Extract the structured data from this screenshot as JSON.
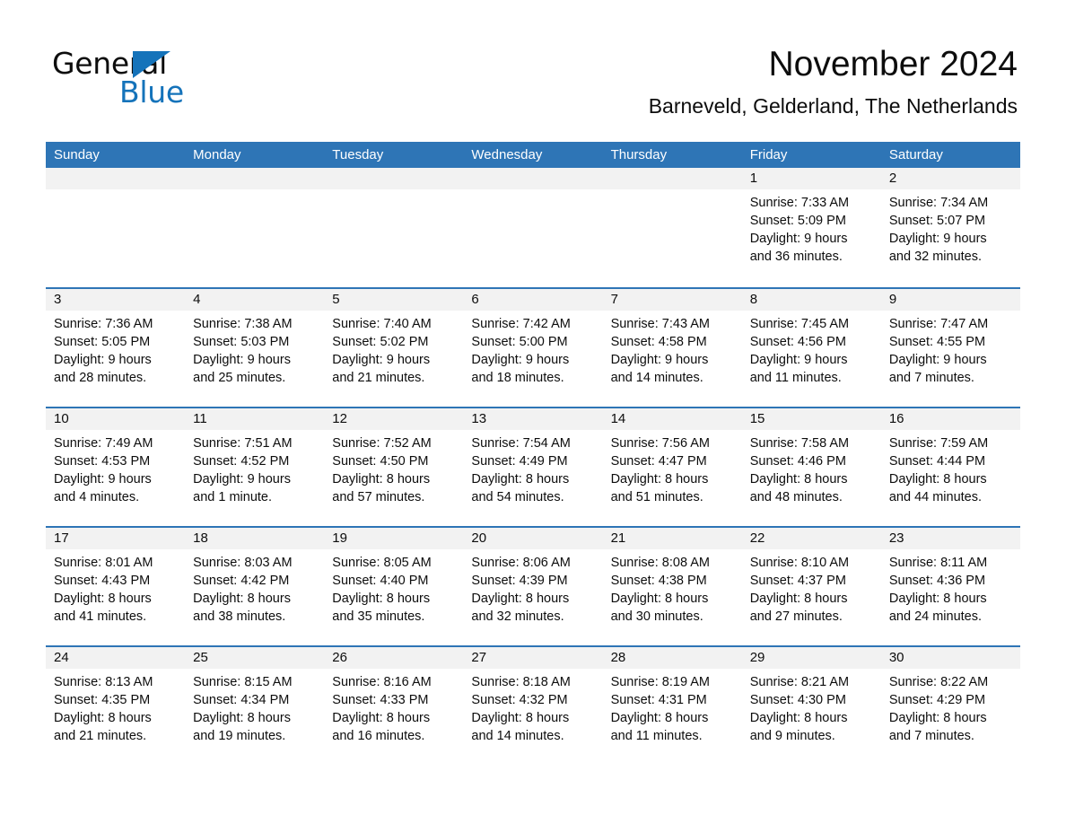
{
  "brand": {
    "word_general": "General",
    "word_blue": "Blue",
    "accent_color": "#1573ba"
  },
  "header": {
    "month_title": "November 2024",
    "location": "Barneveld, Gelderland, The Netherlands",
    "header_bg_color": "#2e75b6",
    "daynum_band_color": "#f2f2f2"
  },
  "weekdays": [
    "Sunday",
    "Monday",
    "Tuesday",
    "Wednesday",
    "Thursday",
    "Friday",
    "Saturday"
  ],
  "weeks": [
    [
      {
        "day": "",
        "sunrise": "",
        "sunset": "",
        "daylight_1": "",
        "daylight_2": ""
      },
      {
        "day": "",
        "sunrise": "",
        "sunset": "",
        "daylight_1": "",
        "daylight_2": ""
      },
      {
        "day": "",
        "sunrise": "",
        "sunset": "",
        "daylight_1": "",
        "daylight_2": ""
      },
      {
        "day": "",
        "sunrise": "",
        "sunset": "",
        "daylight_1": "",
        "daylight_2": ""
      },
      {
        "day": "",
        "sunrise": "",
        "sunset": "",
        "daylight_1": "",
        "daylight_2": ""
      },
      {
        "day": "1",
        "sunrise": "Sunrise: 7:33 AM",
        "sunset": "Sunset: 5:09 PM",
        "daylight_1": "Daylight: 9 hours",
        "daylight_2": "and 36 minutes."
      },
      {
        "day": "2",
        "sunrise": "Sunrise: 7:34 AM",
        "sunset": "Sunset: 5:07 PM",
        "daylight_1": "Daylight: 9 hours",
        "daylight_2": "and 32 minutes."
      }
    ],
    [
      {
        "day": "3",
        "sunrise": "Sunrise: 7:36 AM",
        "sunset": "Sunset: 5:05 PM",
        "daylight_1": "Daylight: 9 hours",
        "daylight_2": "and 28 minutes."
      },
      {
        "day": "4",
        "sunrise": "Sunrise: 7:38 AM",
        "sunset": "Sunset: 5:03 PM",
        "daylight_1": "Daylight: 9 hours",
        "daylight_2": "and 25 minutes."
      },
      {
        "day": "5",
        "sunrise": "Sunrise: 7:40 AM",
        "sunset": "Sunset: 5:02 PM",
        "daylight_1": "Daylight: 9 hours",
        "daylight_2": "and 21 minutes."
      },
      {
        "day": "6",
        "sunrise": "Sunrise: 7:42 AM",
        "sunset": "Sunset: 5:00 PM",
        "daylight_1": "Daylight: 9 hours",
        "daylight_2": "and 18 minutes."
      },
      {
        "day": "7",
        "sunrise": "Sunrise: 7:43 AM",
        "sunset": "Sunset: 4:58 PM",
        "daylight_1": "Daylight: 9 hours",
        "daylight_2": "and 14 minutes."
      },
      {
        "day": "8",
        "sunrise": "Sunrise: 7:45 AM",
        "sunset": "Sunset: 4:56 PM",
        "daylight_1": "Daylight: 9 hours",
        "daylight_2": "and 11 minutes."
      },
      {
        "day": "9",
        "sunrise": "Sunrise: 7:47 AM",
        "sunset": "Sunset: 4:55 PM",
        "daylight_1": "Daylight: 9 hours",
        "daylight_2": "and 7 minutes."
      }
    ],
    [
      {
        "day": "10",
        "sunrise": "Sunrise: 7:49 AM",
        "sunset": "Sunset: 4:53 PM",
        "daylight_1": "Daylight: 9 hours",
        "daylight_2": "and 4 minutes."
      },
      {
        "day": "11",
        "sunrise": "Sunrise: 7:51 AM",
        "sunset": "Sunset: 4:52 PM",
        "daylight_1": "Daylight: 9 hours",
        "daylight_2": "and 1 minute."
      },
      {
        "day": "12",
        "sunrise": "Sunrise: 7:52 AM",
        "sunset": "Sunset: 4:50 PM",
        "daylight_1": "Daylight: 8 hours",
        "daylight_2": "and 57 minutes."
      },
      {
        "day": "13",
        "sunrise": "Sunrise: 7:54 AM",
        "sunset": "Sunset: 4:49 PM",
        "daylight_1": "Daylight: 8 hours",
        "daylight_2": "and 54 minutes."
      },
      {
        "day": "14",
        "sunrise": "Sunrise: 7:56 AM",
        "sunset": "Sunset: 4:47 PM",
        "daylight_1": "Daylight: 8 hours",
        "daylight_2": "and 51 minutes."
      },
      {
        "day": "15",
        "sunrise": "Sunrise: 7:58 AM",
        "sunset": "Sunset: 4:46 PM",
        "daylight_1": "Daylight: 8 hours",
        "daylight_2": "and 48 minutes."
      },
      {
        "day": "16",
        "sunrise": "Sunrise: 7:59 AM",
        "sunset": "Sunset: 4:44 PM",
        "daylight_1": "Daylight: 8 hours",
        "daylight_2": "and 44 minutes."
      }
    ],
    [
      {
        "day": "17",
        "sunrise": "Sunrise: 8:01 AM",
        "sunset": "Sunset: 4:43 PM",
        "daylight_1": "Daylight: 8 hours",
        "daylight_2": "and 41 minutes."
      },
      {
        "day": "18",
        "sunrise": "Sunrise: 8:03 AM",
        "sunset": "Sunset: 4:42 PM",
        "daylight_1": "Daylight: 8 hours",
        "daylight_2": "and 38 minutes."
      },
      {
        "day": "19",
        "sunrise": "Sunrise: 8:05 AM",
        "sunset": "Sunset: 4:40 PM",
        "daylight_1": "Daylight: 8 hours",
        "daylight_2": "and 35 minutes."
      },
      {
        "day": "20",
        "sunrise": "Sunrise: 8:06 AM",
        "sunset": "Sunset: 4:39 PM",
        "daylight_1": "Daylight: 8 hours",
        "daylight_2": "and 32 minutes."
      },
      {
        "day": "21",
        "sunrise": "Sunrise: 8:08 AM",
        "sunset": "Sunset: 4:38 PM",
        "daylight_1": "Daylight: 8 hours",
        "daylight_2": "and 30 minutes."
      },
      {
        "day": "22",
        "sunrise": "Sunrise: 8:10 AM",
        "sunset": "Sunset: 4:37 PM",
        "daylight_1": "Daylight: 8 hours",
        "daylight_2": "and 27 minutes."
      },
      {
        "day": "23",
        "sunrise": "Sunrise: 8:11 AM",
        "sunset": "Sunset: 4:36 PM",
        "daylight_1": "Daylight: 8 hours",
        "daylight_2": "and 24 minutes."
      }
    ],
    [
      {
        "day": "24",
        "sunrise": "Sunrise: 8:13 AM",
        "sunset": "Sunset: 4:35 PM",
        "daylight_1": "Daylight: 8 hours",
        "daylight_2": "and 21 minutes."
      },
      {
        "day": "25",
        "sunrise": "Sunrise: 8:15 AM",
        "sunset": "Sunset: 4:34 PM",
        "daylight_1": "Daylight: 8 hours",
        "daylight_2": "and 19 minutes."
      },
      {
        "day": "26",
        "sunrise": "Sunrise: 8:16 AM",
        "sunset": "Sunset: 4:33 PM",
        "daylight_1": "Daylight: 8 hours",
        "daylight_2": "and 16 minutes."
      },
      {
        "day": "27",
        "sunrise": "Sunrise: 8:18 AM",
        "sunset": "Sunset: 4:32 PM",
        "daylight_1": "Daylight: 8 hours",
        "daylight_2": "and 14 minutes."
      },
      {
        "day": "28",
        "sunrise": "Sunrise: 8:19 AM",
        "sunset": "Sunset: 4:31 PM",
        "daylight_1": "Daylight: 8 hours",
        "daylight_2": "and 11 minutes."
      },
      {
        "day": "29",
        "sunrise": "Sunrise: 8:21 AM",
        "sunset": "Sunset: 4:30 PM",
        "daylight_1": "Daylight: 8 hours",
        "daylight_2": "and 9 minutes."
      },
      {
        "day": "30",
        "sunrise": "Sunrise: 8:22 AM",
        "sunset": "Sunset: 4:29 PM",
        "daylight_1": "Daylight: 8 hours",
        "daylight_2": "and 7 minutes."
      }
    ]
  ]
}
